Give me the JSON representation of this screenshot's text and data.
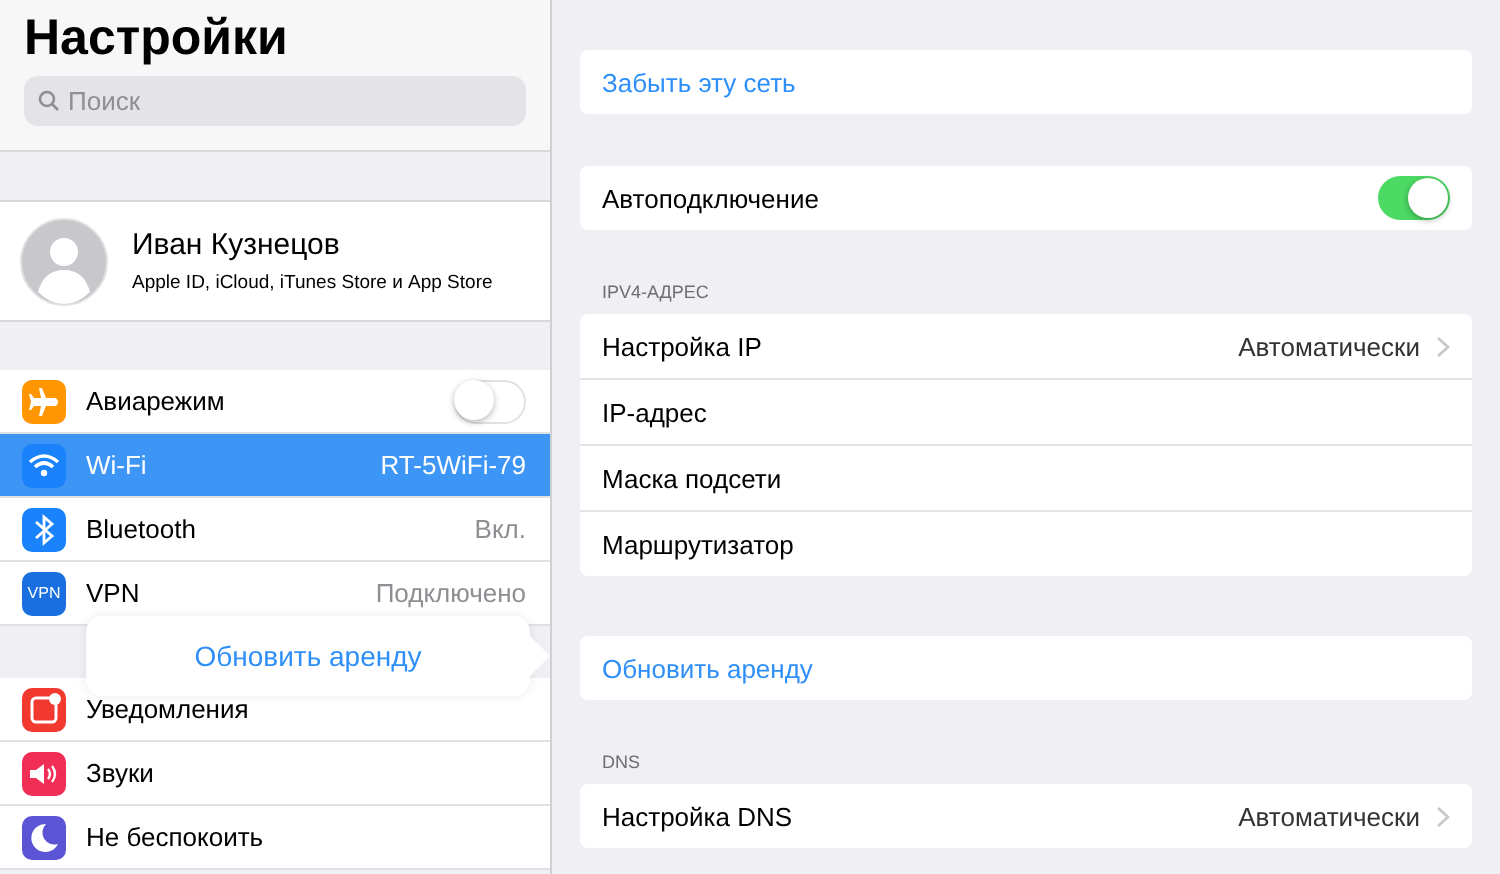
{
  "sidebar": {
    "title": "Настройки",
    "search": {
      "placeholder": "Поиск"
    },
    "profile": {
      "name": "Иван Кузнецов",
      "subtitle": "Apple ID, iCloud, iTunes Store и App Store"
    },
    "groups": [
      [
        {
          "kind": "toggle",
          "label": "Авиарежим",
          "on": false,
          "selected": false,
          "color": "#ff9500"
        },
        {
          "kind": "value",
          "label": "Wi-Fi",
          "value": "RT-5WiFi-79",
          "selected": true,
          "color": "#1a82fb"
        },
        {
          "kind": "value",
          "label": "Bluetooth",
          "value": "Вкл.",
          "selected": false,
          "color": "#1a82fb"
        },
        {
          "kind": "value",
          "label": "VPN",
          "value": "Подключено",
          "selected": false,
          "color": "#1a6fe0",
          "badge": "VPN"
        }
      ],
      [
        {
          "kind": "plain",
          "label": "Уведомления",
          "selected": false,
          "color": "#f2392f"
        },
        {
          "kind": "plain",
          "label": "Звуки",
          "selected": false,
          "color": "#f12e55"
        },
        {
          "kind": "plain",
          "label": "Не беспокоить",
          "selected": false,
          "color": "#5b55d6"
        }
      ]
    ]
  },
  "popover": {
    "label": "Обновить аренду"
  },
  "detail": {
    "sections": [
      {
        "rows": [
          {
            "kind": "action",
            "label": "Забыть эту сеть"
          }
        ]
      },
      {
        "rows": [
          {
            "kind": "toggle",
            "label": "Автоподключение",
            "on": true
          }
        ]
      },
      {
        "header": "IPV4-АДРЕС",
        "rows": [
          {
            "kind": "nav",
            "label": "Настройка IP",
            "value": "Автоматически"
          },
          {
            "kind": "plain",
            "label": "IP-адрес"
          },
          {
            "kind": "plain",
            "label": "Маска подсети"
          },
          {
            "kind": "plain",
            "label": "Маршрутизатор"
          }
        ]
      },
      {
        "rows": [
          {
            "kind": "action",
            "label": "Обновить аренду"
          }
        ]
      },
      {
        "header": "DNS",
        "rows": [
          {
            "kind": "nav",
            "label": "Настройка DNS",
            "value": "Автоматически"
          }
        ]
      }
    ]
  }
}
